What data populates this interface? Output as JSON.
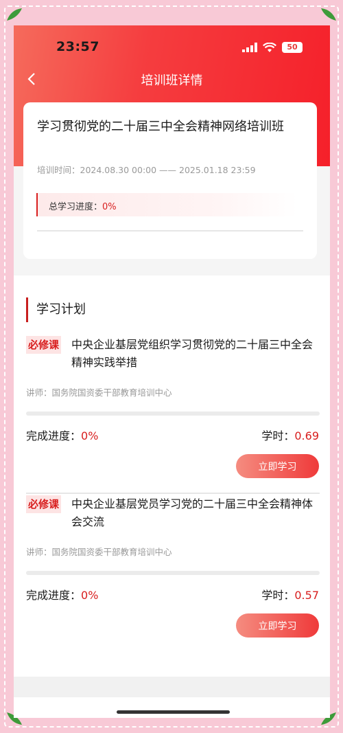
{
  "status": {
    "time": "23:57",
    "battery": "50"
  },
  "nav": {
    "title": "培训班详情"
  },
  "course": {
    "title": "学习贯彻党的二十届三中全会精神网络培训班",
    "time": "培训时间：2024.08.30 00:00 —— 2025.01.18 23:59",
    "progress_label": "总学习进度：",
    "progress_value": "0%"
  },
  "plan": {
    "heading": "学习计划",
    "items": [
      {
        "tag": "必修课",
        "title": "中央企业基层党组织学习贯彻党的二十届三中全会精神实践举措",
        "teacher": "讲师：国务院国资委干部教育培训中心",
        "progress_label": "完成进度：",
        "progress_value": "0%",
        "progress": 0,
        "hours_label": "学时：",
        "hours_value": "0.69",
        "button": "立即学习"
      },
      {
        "tag": "必修课",
        "title": "中央企业基层党员学习党的二十届三中全会精神体会交流",
        "teacher": "讲师：国务院国资委干部教育培训中心",
        "progress_label": "完成进度：",
        "progress_value": "0%",
        "progress": 0,
        "hours_label": "学时：",
        "hours_value": "0.57",
        "button": "立即学习"
      }
    ]
  },
  "colors": {
    "accent": "#d81e1e",
    "header": "#f5202a",
    "frame": "#f8c9d6"
  },
  "icons": {
    "back": "chevron-left-icon",
    "signal": "signal-icon",
    "wifi": "wifi-icon",
    "battery": "battery-icon"
  }
}
